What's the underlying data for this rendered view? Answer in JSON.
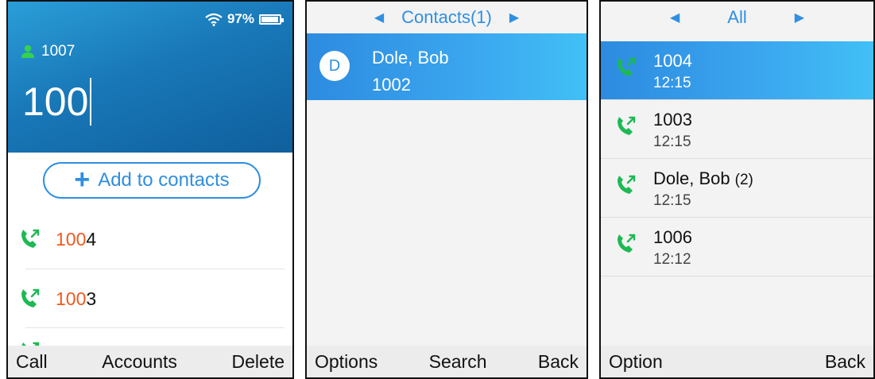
{
  "dialer": {
    "battery_percent": "97%",
    "battery_level": 0.97,
    "account": "1007",
    "dial_input": "100",
    "add_contacts_label": "Add to contacts",
    "results": [
      {
        "match": "100",
        "rest": "4"
      },
      {
        "match": "100",
        "rest": "3"
      }
    ],
    "softkeys": {
      "left": "Call",
      "middle": "Accounts",
      "right": "Delete"
    }
  },
  "contacts": {
    "header_title": "Contacts(1)",
    "items": [
      {
        "initial": "D",
        "name": "Dole, Bob",
        "number": "1002"
      }
    ],
    "softkeys": {
      "left": "Options",
      "middle": "Search",
      "right": "Back"
    }
  },
  "history": {
    "header_title": "All",
    "items": [
      {
        "name": "1004",
        "count": "",
        "time": "12:15"
      },
      {
        "name": "1003",
        "count": "",
        "time": "12:15"
      },
      {
        "name": "Dole, Bob",
        "count": "(2)",
        "time": "12:15"
      },
      {
        "name": "1006",
        "count": "",
        "time": "12:12"
      }
    ],
    "softkeys": {
      "left": "Option",
      "right": "Back"
    }
  },
  "colors": {
    "accent_blue": "#2f8fe0",
    "match_orange": "#ef5a1d",
    "call_green": "#1db954"
  },
  "icons": {
    "call": "outgoing-call-icon",
    "person": "person-icon",
    "wifi": "wifi-icon",
    "battery": "battery-icon",
    "prev": "triangle-left-icon",
    "next": "triangle-right-icon"
  }
}
